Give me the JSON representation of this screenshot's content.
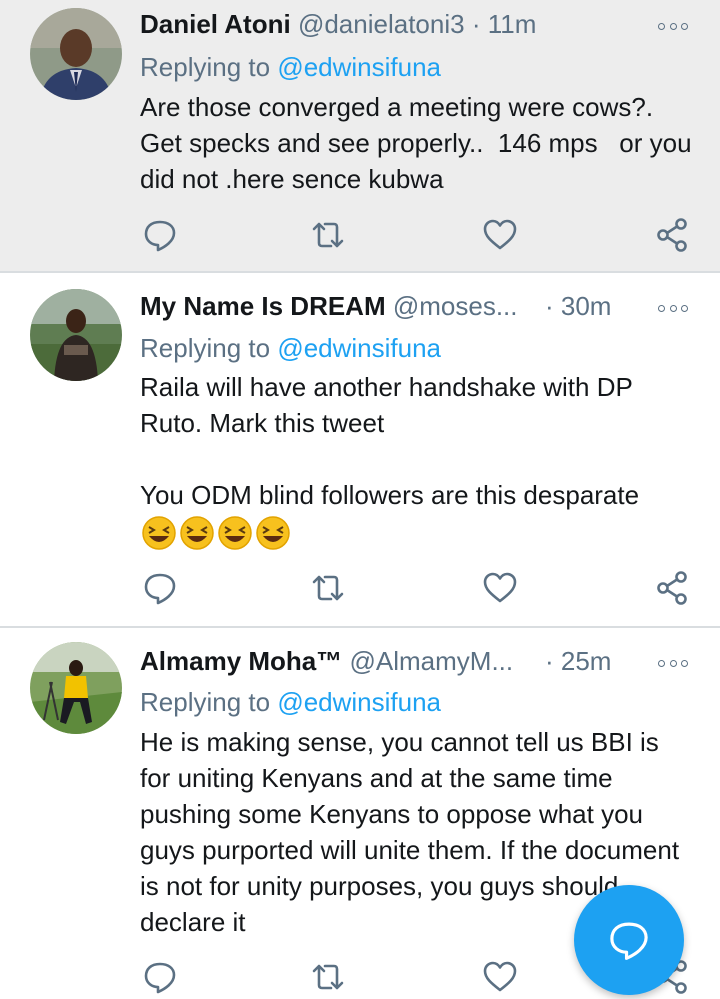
{
  "tweets": [
    {
      "name": "Daniel Atoni",
      "handle": "@danielatoni3",
      "time": "· 11m",
      "replying_prefix": "Replying to ",
      "replying_to": "@edwinsifuna",
      "body": "Are those converged a meeting were cows?. Get specks and see properly..  146 mps   or you did not .here sence kubwa"
    },
    {
      "name": "My Name Is DREAM",
      "handle": "@moses...",
      "time": "· 30m",
      "replying_prefix": "Replying to ",
      "replying_to": "@edwinsifuna",
      "body": "Raila will have another handshake with DP Ruto. Mark this tweet\n\nYou ODM blind followers are this desparate",
      "emoji_count": 4
    },
    {
      "name": "Almamy Moha™",
      "handle": "@AlmamyM...",
      "time": "· 25m",
      "replying_prefix": "Replying to ",
      "replying_to": "@edwinsifuna",
      "body": "He is making sense, you cannot tell us BBI is for uniting Kenyans and at the same time pushing some Kenyans to oppose what you guys purported will unite them. If the document is not for unity purposes, you guys should declare it"
    }
  ],
  "icons": {
    "reply": "reply-icon",
    "retweet": "retweet-icon",
    "like": "heart-icon",
    "share": "share-icon",
    "more": "more-options-icon",
    "compose": "compose-reply-icon"
  },
  "colors": {
    "accent": "#1da1f2",
    "muted": "#5b7083",
    "highlight_bg": "#ededed"
  }
}
